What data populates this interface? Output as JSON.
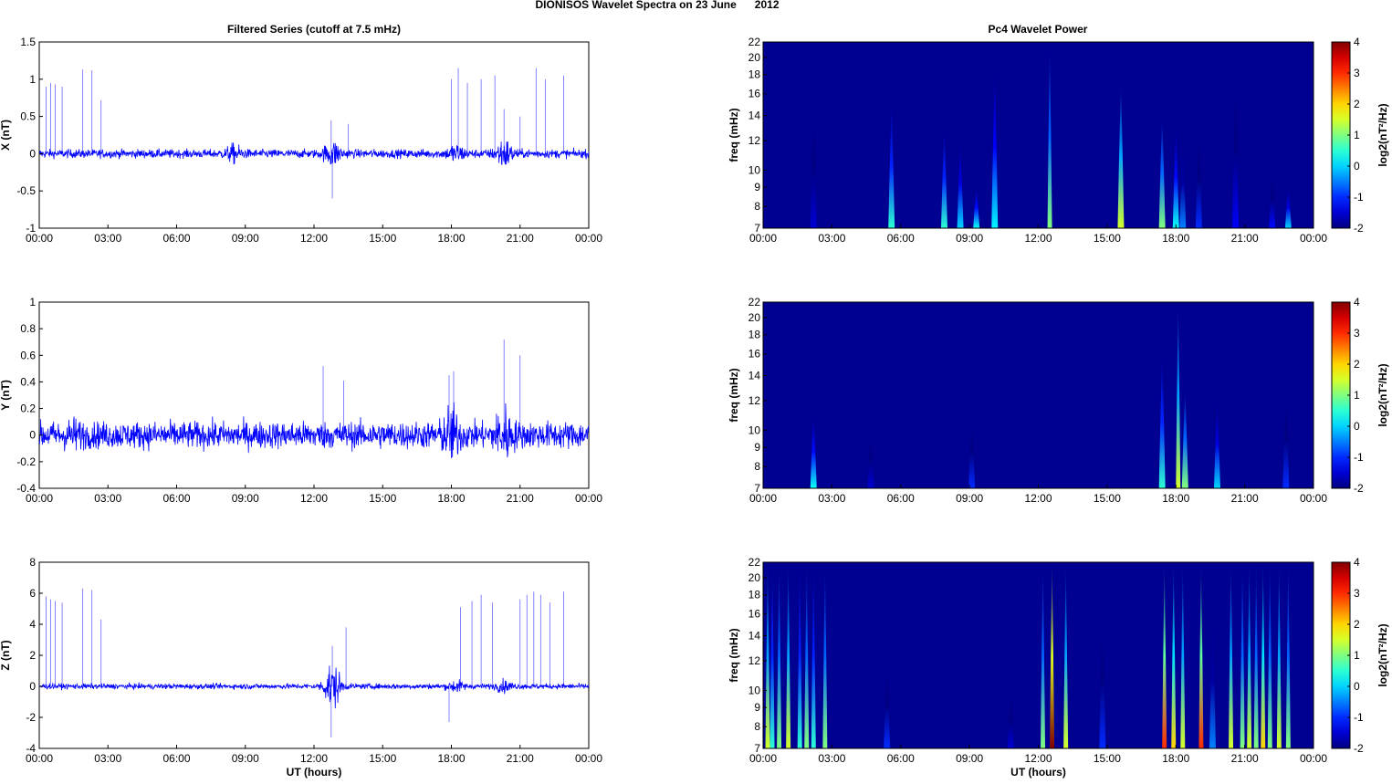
{
  "title": "DIONISOS Wavelet Spectra on 23 June      2012",
  "left_title": "Filtered Series (cutoff at 7.5 mHz)",
  "right_title": "Pc4 Wavelet Power",
  "xlabel": "UT (hours)",
  "x_ticks": [
    "00:00",
    "03:00",
    "06:00",
    "09:00",
    "12:00",
    "15:00",
    "18:00",
    "21:00",
    "00:00"
  ],
  "freq_label": "freq (mHz)",
  "freq_ticks": [
    7,
    8,
    9,
    10,
    12,
    14,
    16,
    18,
    20,
    22
  ],
  "colorbar": {
    "label": "log2(nT²/Hz)",
    "ticks": [
      4,
      3,
      2,
      1,
      0,
      -1,
      -2
    ],
    "range": [
      -2,
      4
    ]
  },
  "line_color": "#0000ff",
  "chart_data": [
    {
      "type": "line",
      "name": "X",
      "ylabel": "X (nT)",
      "ylim": [
        -1,
        1.5
      ],
      "yticks": [
        1.5,
        1,
        0.5,
        0,
        -0.5,
        -1
      ],
      "xlim": [
        0,
        24
      ],
      "noise": 0.04,
      "bursts": [
        [
          8.5,
          0.06
        ],
        [
          12.8,
          0.1
        ],
        [
          18.2,
          0.07
        ],
        [
          20.3,
          0.12
        ]
      ],
      "spikes": [
        [
          0.3,
          0.9
        ],
        [
          0.5,
          0.95
        ],
        [
          0.7,
          0.93
        ],
        [
          1.0,
          0.9
        ],
        [
          1.9,
          1.13
        ],
        [
          2.3,
          1.12
        ],
        [
          2.7,
          0.72
        ],
        [
          12.75,
          0.45
        ],
        [
          12.8,
          -0.6
        ],
        [
          13.5,
          0.4
        ],
        [
          18.0,
          1.0
        ],
        [
          18.3,
          1.15
        ],
        [
          18.7,
          0.95
        ],
        [
          19.3,
          1.0
        ],
        [
          19.9,
          1.05
        ],
        [
          20.3,
          0.6
        ],
        [
          21.0,
          0.5
        ],
        [
          21.7,
          1.15
        ],
        [
          22.1,
          1.0
        ],
        [
          22.9,
          1.05
        ]
      ]
    },
    {
      "type": "line",
      "name": "Y",
      "ylabel": "Y (nT)",
      "ylim": [
        -0.4,
        1
      ],
      "yticks": [
        1,
        0.8,
        0.6,
        0.4,
        0.2,
        0,
        -0.2,
        -0.4
      ],
      "xlim": [
        0,
        24
      ],
      "noise": 0.07,
      "bursts": [
        [
          1.5,
          0.03
        ],
        [
          18.0,
          0.1
        ],
        [
          20.3,
          0.1
        ]
      ],
      "spikes": [
        [
          12.4,
          0.52
        ],
        [
          13.3,
          0.41
        ],
        [
          17.9,
          0.45
        ],
        [
          18.1,
          0.48
        ],
        [
          20.3,
          0.72
        ],
        [
          21.0,
          0.6
        ]
      ]
    },
    {
      "type": "line",
      "name": "Z",
      "ylabel": "Z (nT)",
      "ylim": [
        -4,
        8
      ],
      "yticks": [
        8,
        6,
        4,
        2,
        0,
        -2,
        -4
      ],
      "xlim": [
        0,
        24
      ],
      "noise": 0.12,
      "bursts": [
        [
          12.8,
          1.0
        ],
        [
          18.2,
          0.2
        ],
        [
          20.3,
          0.2
        ]
      ],
      "spikes": [
        [
          0.3,
          5.8
        ],
        [
          0.5,
          5.6
        ],
        [
          0.7,
          5.5
        ],
        [
          1.0,
          5.4
        ],
        [
          1.9,
          6.3
        ],
        [
          2.3,
          6.2
        ],
        [
          2.7,
          4.3
        ],
        [
          12.8,
          2.6
        ],
        [
          12.75,
          -3.3
        ],
        [
          13.4,
          3.8
        ],
        [
          17.9,
          -2.3
        ],
        [
          18.4,
          5.1
        ],
        [
          18.9,
          5.5
        ],
        [
          19.3,
          5.9
        ],
        [
          19.8,
          5.4
        ],
        [
          21.0,
          5.6
        ],
        [
          21.3,
          5.9
        ],
        [
          21.6,
          6.1
        ],
        [
          21.9,
          5.9
        ],
        [
          22.3,
          5.4
        ],
        [
          22.9,
          6.1
        ]
      ]
    },
    {
      "type": "heatmap",
      "name": "X-spectrum",
      "xlim": [
        0,
        24
      ],
      "ylim": [
        7,
        22
      ],
      "yscale": "log",
      "streaks": [
        [
          2.2,
          15,
          -1.5
        ],
        [
          5.6,
          15,
          0.5
        ],
        [
          7.9,
          13,
          0.5
        ],
        [
          8.6,
          12,
          0
        ],
        [
          9.3,
          9,
          0.3
        ],
        [
          10.1,
          19,
          0.2
        ],
        [
          12.5,
          22,
          1
        ],
        [
          15.6,
          17,
          1.5
        ],
        [
          17.4,
          14,
          1
        ],
        [
          18.0,
          13,
          0.3
        ],
        [
          18.3,
          12,
          -0.5
        ],
        [
          19.0,
          13,
          -1
        ],
        [
          20.6,
          19,
          -1.3
        ],
        [
          22.2,
          10,
          -1.2
        ],
        [
          22.9,
          9,
          0
        ]
      ]
    },
    {
      "type": "heatmap",
      "name": "Y-spectrum",
      "xlim": [
        0,
        24
      ],
      "ylim": [
        7,
        22
      ],
      "yscale": "log",
      "streaks": [
        [
          2.2,
          11,
          0.3
        ],
        [
          4.7,
          10,
          -1.5
        ],
        [
          9.1,
          11,
          -1
        ],
        [
          17.4,
          16,
          0.5
        ],
        [
          18.1,
          22,
          1.5
        ],
        [
          18.4,
          13,
          1
        ],
        [
          19.8,
          12,
          0
        ],
        [
          22.8,
          13,
          -1
        ]
      ]
    },
    {
      "type": "heatmap",
      "name": "Z-spectrum",
      "xlim": [
        0,
        24
      ],
      "ylim": [
        7,
        22
      ],
      "yscale": "log",
      "streaks": [
        [
          0.2,
          22,
          1.5
        ],
        [
          0.4,
          22,
          0.5
        ],
        [
          0.7,
          22,
          1
        ],
        [
          1.1,
          22,
          1.5
        ],
        [
          1.6,
          22,
          0.5
        ],
        [
          1.9,
          22,
          1
        ],
        [
          2.2,
          22,
          0.5
        ],
        [
          2.7,
          22,
          1
        ],
        [
          5.4,
          12,
          -1
        ],
        [
          10.8,
          10,
          -1.5
        ],
        [
          12.2,
          22,
          1
        ],
        [
          12.6,
          22,
          4
        ],
        [
          13.2,
          22,
          1.5
        ],
        [
          14.8,
          16,
          -1
        ],
        [
          17.5,
          22,
          3
        ],
        [
          17.9,
          22,
          2
        ],
        [
          18.3,
          22,
          1.5
        ],
        [
          19.1,
          22,
          3
        ],
        [
          19.6,
          16,
          -0.5
        ],
        [
          20.4,
          22,
          1.5
        ],
        [
          20.9,
          22,
          1
        ],
        [
          21.2,
          22,
          1.5
        ],
        [
          21.5,
          22,
          1
        ],
        [
          21.8,
          22,
          2
        ],
        [
          22.1,
          22,
          1
        ],
        [
          22.5,
          22,
          1.5
        ],
        [
          22.9,
          22,
          1
        ]
      ]
    }
  ]
}
